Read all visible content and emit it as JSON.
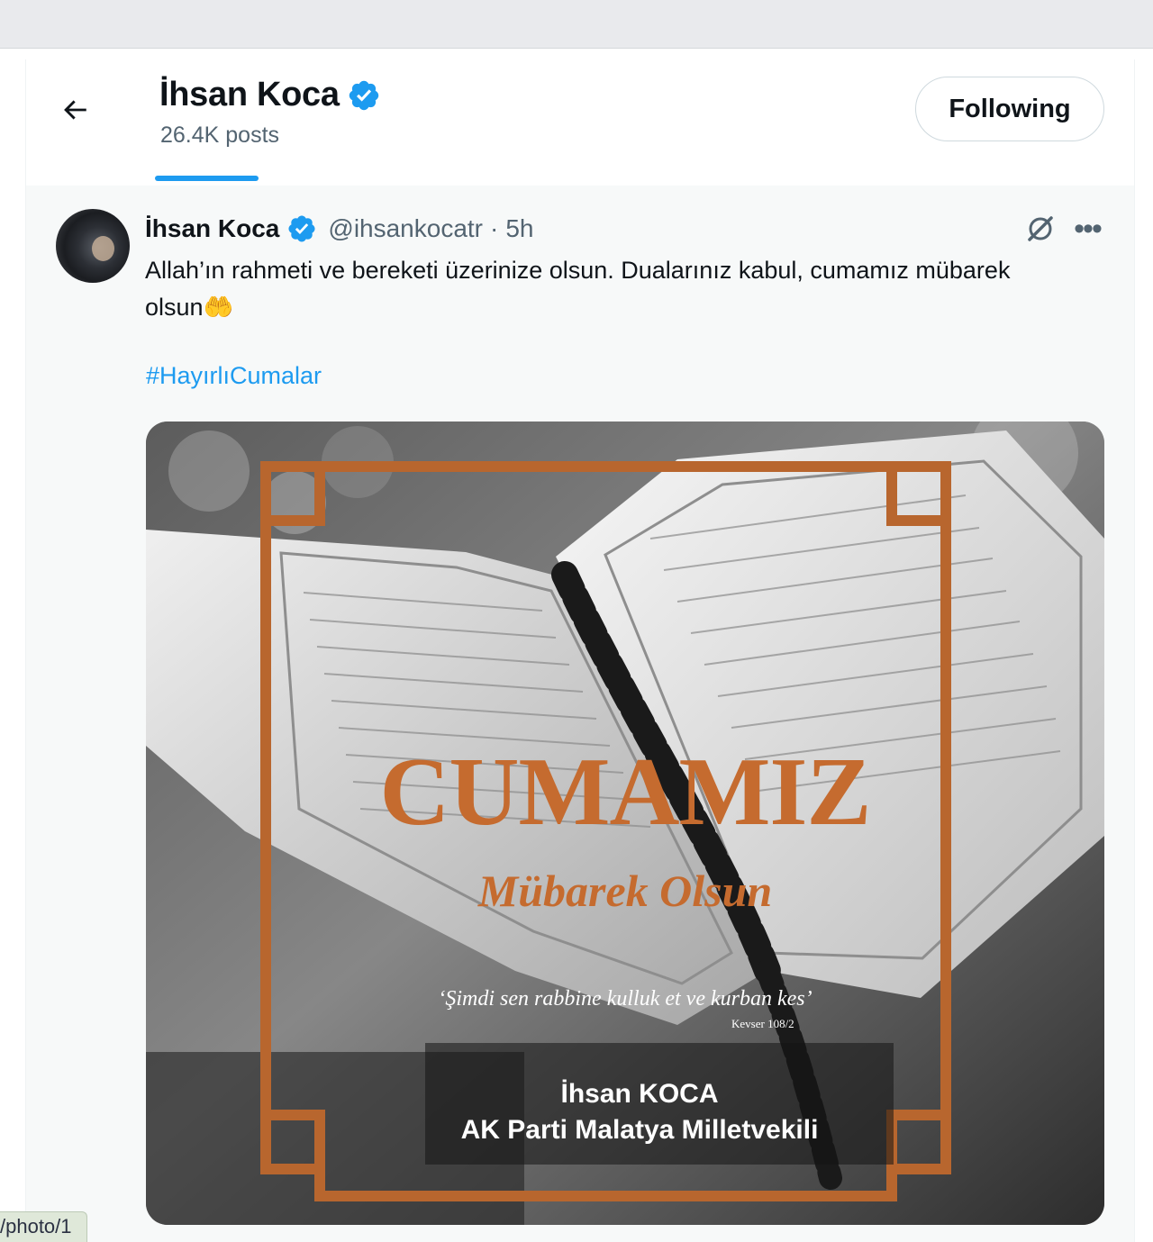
{
  "header": {
    "name": "İhsan Koca",
    "posts_count": "26.4K posts",
    "follow_button_label": "Following"
  },
  "tweet": {
    "author_name": "İhsan Koca",
    "handle": "@ihsankocatr",
    "separator": "·",
    "time": "5h",
    "text": "Allah’ın rahmeti ve bereketi üzerinize olsun. Dualarınız kabul, cumamız mübarek olsun🤲",
    "hashtag": "#HayırlıCumalar",
    "image": {
      "headline": "CUMAMIZ",
      "subheadline": "Mübarek Olsun",
      "quote": "‘Şimdi sen rabbine kulluk et ve kurban kes’",
      "quote_source": "Kevser 108/2",
      "signature_name": "İhsan KOCA",
      "signature_title": "AK Parti Malatya Milletvekili"
    }
  },
  "status_bar": {
    "url": "/photo/1"
  },
  "icons": {
    "back": "arrow-left-icon",
    "verified": "verified-badge-icon",
    "grok": "grok-icon",
    "more": "more-icon"
  },
  "colors": {
    "accent": "#1d9bf0",
    "muted_text": "#536471",
    "image_frame": "#b8662e"
  }
}
